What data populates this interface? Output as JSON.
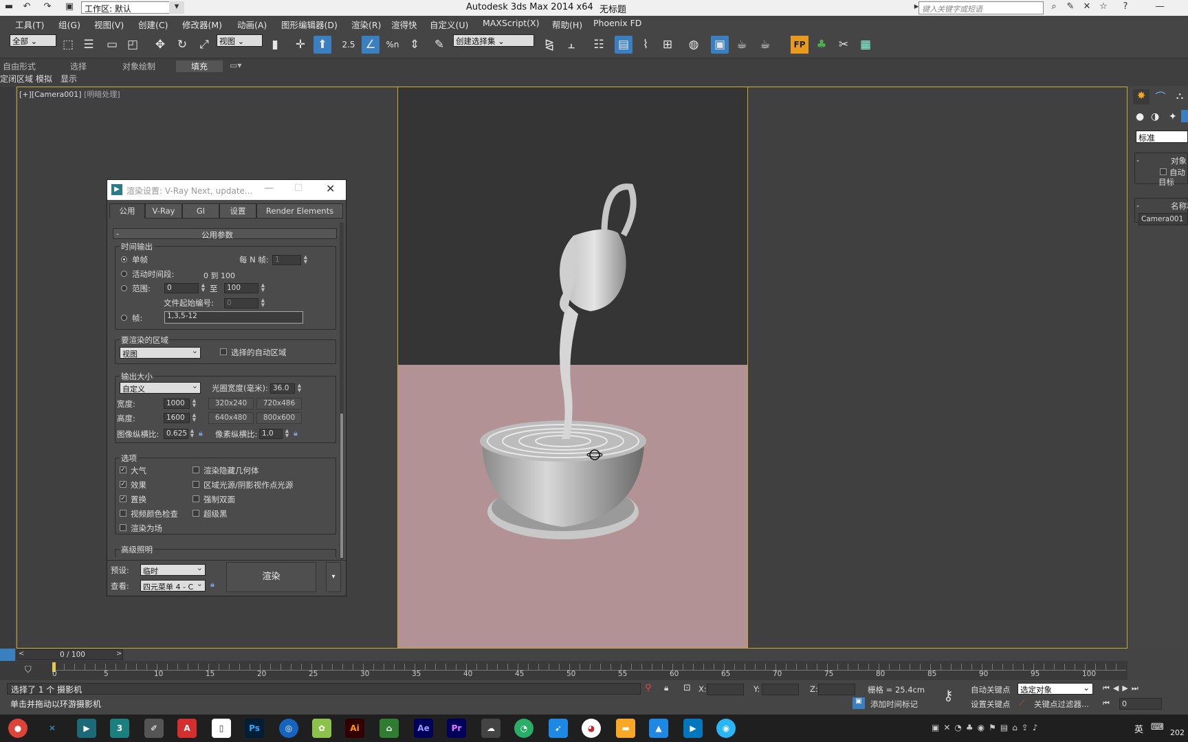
{
  "title_bar": {
    "workspace": "工作区: 默认",
    "app_title": "Autodesk 3ds Max  2014 x64",
    "doc_title": "无标题",
    "search_placeholder": "键入关键字或短语"
  },
  "menu": [
    "工具(T)",
    "组(G)",
    "视图(V)",
    "创建(C)",
    "修改器(M)",
    "动画(A)",
    "图形编辑器(D)",
    "渲染(R)",
    "渲得快",
    "自定义(U)",
    "MAXScript(X)",
    "帮助(H)",
    "Phoenix FD"
  ],
  "toolbar": {
    "selection_filter": "全部",
    "ref_coord": "视图",
    "named_selection": "创建选择集",
    "snap_label": "2.5",
    "percent_snap": "%n"
  },
  "ribbon": {
    "tabs": [
      "自由形式",
      "选择",
      "对象绘制",
      "填充"
    ],
    "active_tab": "填充",
    "subtabs": [
      "定闭区域",
      "模拟",
      "显示"
    ]
  },
  "viewport": {
    "label_plus": "[+]",
    "label_camera": "[Camera001]",
    "label_shading": "[明暗处理]"
  },
  "command_panel": {
    "category": "标准",
    "rollout1": "对象",
    "auto_label": "自动",
    "target_label": "目标",
    "rollout2": "名称和",
    "name_value": "Camera001"
  },
  "dialog": {
    "title": "渲染设置: V-Ray Next, update...",
    "tabs": [
      "公用",
      "V-Ray",
      "GI",
      "设置",
      "Render Elements"
    ],
    "rollout": "公用参数",
    "time_output": {
      "group": "时间输出",
      "single": "单帧",
      "every_n": "每 N 帧:",
      "every_n_val": "1",
      "active": "活动时间段:",
      "active_range": "0 到 100",
      "range": "范围:",
      "range_from": "0",
      "to": "至",
      "range_to": "100",
      "file_start": "文件起始编号:",
      "file_start_val": "0",
      "frames": "帧:",
      "frames_val": "1,3,5-12"
    },
    "area": {
      "group": "要渲染的区域",
      "value": "视图",
      "auto_region": "选择的自动区域"
    },
    "output_size": {
      "group": "输出大小",
      "preset": "自定义",
      "aperture_label": "光圈宽度(毫米):",
      "aperture_val": "36.0",
      "width_label": "宽度:",
      "width_val": "1000",
      "height_label": "高度:",
      "height_val": "1600",
      "presets": [
        "320x240",
        "720x486",
        "640x480",
        "800x600"
      ],
      "image_aspect_label": "图像纵横比:",
      "image_aspect_val": "0.625",
      "pixel_aspect_label": "像素纵横比:",
      "pixel_aspect_val": "1.0"
    },
    "options": {
      "group": "选项",
      "items": [
        {
          "label": "大气",
          "checked": true
        },
        {
          "label": "渲染隐藏几何体",
          "checked": false
        },
        {
          "label": "效果",
          "checked": true
        },
        {
          "label": "区域光源/阴影视作点光源",
          "checked": false
        },
        {
          "label": "置换",
          "checked": true
        },
        {
          "label": "强制双面",
          "checked": false
        },
        {
          "label": "视频颜色检查",
          "checked": false
        },
        {
          "label": "超级黑",
          "checked": false
        },
        {
          "label": "渲染为场",
          "checked": false
        }
      ]
    },
    "advanced_lighting": "高级照明",
    "preset_label": "预设:",
    "preset_value": "临时",
    "view_label": "查看:",
    "view_value": "四元菜单 4 - C",
    "render_button": "渲染"
  },
  "timeline": {
    "slider": "0 / 100",
    "ticks": [
      "0",
      "5",
      "10",
      "15",
      "20",
      "25",
      "30",
      "35",
      "40",
      "45",
      "50",
      "55",
      "60",
      "65",
      "70",
      "75",
      "80",
      "85",
      "90",
      "95",
      "100"
    ]
  },
  "status": {
    "selected": "选择了 1 个 摄影机",
    "prompt": "单击并拖动以环游摄影机",
    "x_label": "X:",
    "y_label": "Y:",
    "z_label": "Z:",
    "grid": "栅格 = 25.4cm",
    "auto_key": "自动关键点",
    "set_key": "设置关键点",
    "selected_obj": "选定对象",
    "key_filter": "关键点过滤器...",
    "add_time_tag": "添加时间标记",
    "frame_val": "0"
  },
  "taskbar": {
    "apps": [
      "chrome",
      "xmind",
      "3dsmax",
      "3dsmax2",
      "notes",
      "pdf",
      "doc",
      "Ps",
      "app",
      "app2",
      "Ai",
      "app3",
      "Ae",
      "Pr",
      "app4",
      "wechat",
      "app5",
      "browser",
      "folder",
      "photos",
      "video",
      "app6"
    ],
    "ime": "英",
    "clock_partial": "202"
  }
}
